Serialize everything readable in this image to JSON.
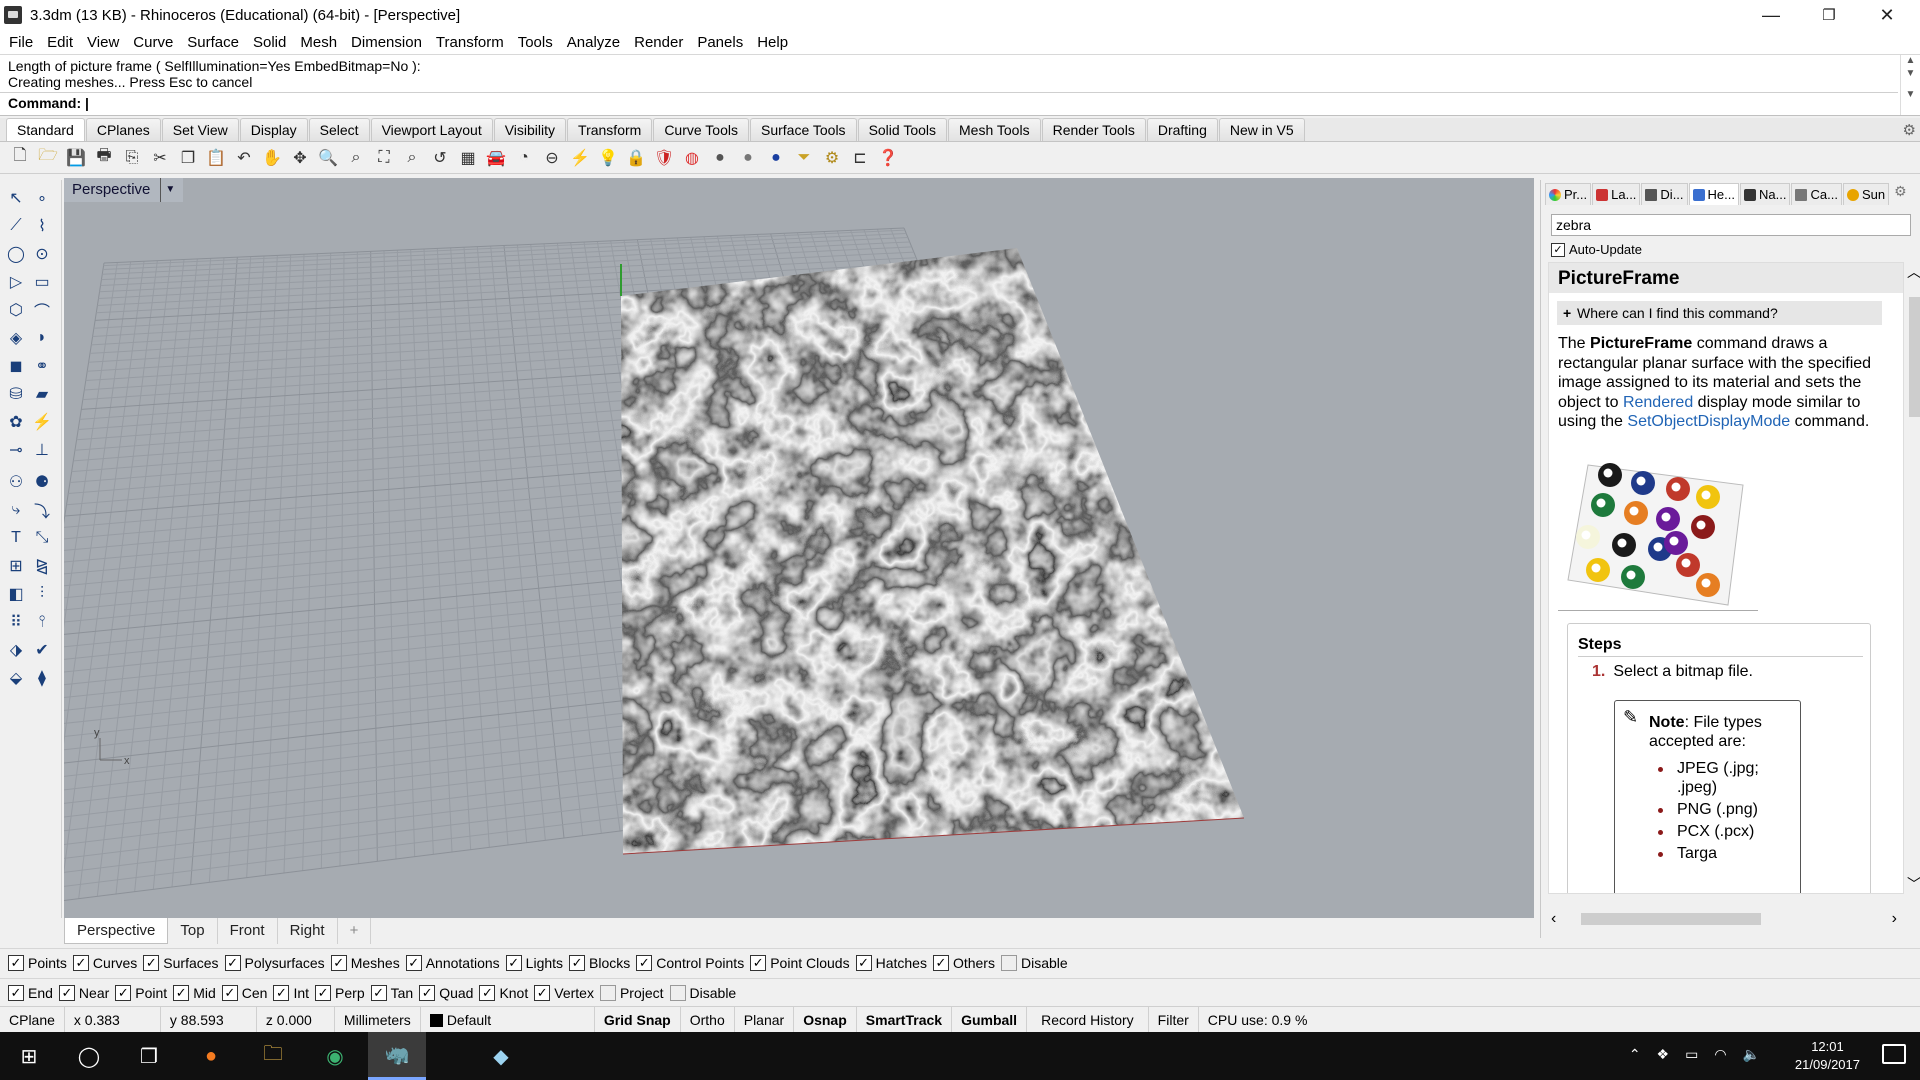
{
  "window": {
    "title": "3.3dm (13 KB) - Rhinoceros (Educational) (64-bit) - [Perspective]",
    "controls": {
      "minimize": "—",
      "maximize": "❐",
      "close": "✕"
    }
  },
  "menu": [
    "File",
    "Edit",
    "View",
    "Curve",
    "Surface",
    "Solid",
    "Mesh",
    "Dimension",
    "Transform",
    "Tools",
    "Analyze",
    "Render",
    "Panels",
    "Help"
  ],
  "command": {
    "history": [
      "Length of picture frame ( SelfIllumination=Yes  EmbedBitmap=No ):",
      "Creating meshes... Press Esc to cancel"
    ],
    "prompt": "Command:"
  },
  "toolbar_tabs": [
    "Standard",
    "CPlanes",
    "Set View",
    "Display",
    "Select",
    "Viewport Layout",
    "Visibility",
    "Transform",
    "Curve Tools",
    "Surface Tools",
    "Solid Tools",
    "Mesh Tools",
    "Render Tools",
    "Drafting",
    "New in V5"
  ],
  "toolbar_icons": [
    "new-icon",
    "open-icon",
    "save-icon",
    "print-icon",
    "import-icon",
    "cut-icon",
    "copy-icon",
    "paste-icon",
    "undo-icon",
    "pan-icon",
    "rotate-view-icon",
    "zoom-icon",
    "zoom-window-icon",
    "zoom-extents-icon",
    "zoom-selected-icon",
    "undo-view-icon",
    "four-view-icon",
    "car-icon",
    "camera-icon",
    "cplane-icon",
    "snap-icon",
    "light-icon",
    "lock-icon",
    "material-icon",
    "color-wheel-icon",
    "shade-icon",
    "render-sphere-icon",
    "render-icon",
    "filter-icon",
    "settings-icon",
    "dimension-icon",
    "help-icon"
  ],
  "viewport": {
    "title": "Perspective",
    "axis_x": "x",
    "axis_y": "y"
  },
  "view_tabs": [
    "Perspective",
    "Top",
    "Front",
    "Right",
    "+"
  ],
  "panel": {
    "tabs": [
      "Pr...",
      "La...",
      "Di...",
      "He...",
      "Na...",
      "Ca...",
      "Sun"
    ],
    "search_value": "zebra",
    "auto_update": "Auto-Update",
    "help": {
      "heading": "PictureFrame",
      "find": "Where can I find this command?",
      "intro_1": "The ",
      "intro_cmd": "PictureFrame",
      "intro_2": " command draws a rectangular planar surface with the specified image assigned to its material and sets the object to ",
      "intro_link1": "Rendered",
      "intro_3": " display mode similar to using the ",
      "intro_link2": "SetObjectDisplayMode",
      "intro_4": " command.",
      "steps_heading": "Steps",
      "step_num": "1.",
      "step_text": "Select a bitmap file.",
      "note_label": "Note",
      "note_text": ": File types accepted are:",
      "file_types": [
        "JPEG (.jpg; .jpeg)",
        "PNG (.png)",
        "PCX (.pcx)",
        "Targa"
      ]
    }
  },
  "object_filter": [
    "Points",
    "Curves",
    "Surfaces",
    "Polysurfaces",
    "Meshes",
    "Annotations",
    "Lights",
    "Blocks",
    "Control Points",
    "Point Clouds",
    "Hatches",
    "Others",
    "Disable"
  ],
  "osnap": [
    "End",
    "Near",
    "Point",
    "Mid",
    "Cen",
    "Int",
    "Perp",
    "Tan",
    "Quad",
    "Knot",
    "Vertex",
    "Project",
    "Disable"
  ],
  "status": {
    "cplane": "CPlane",
    "x": "x 0.383",
    "y": "y 88.593",
    "z": "z 0.000",
    "units": "Millimeters",
    "layer": "Default",
    "grid_snap": "Grid Snap",
    "ortho": "Ortho",
    "planar": "Planar",
    "osnap": "Osnap",
    "smarttrack": "SmartTrack",
    "gumball": "Gumball",
    "record_history": "Record History",
    "filter": "Filter",
    "cpu": "CPU use: 0.9 %"
  },
  "taskbar": {
    "time": "12:01",
    "date": "21/09/2017"
  }
}
